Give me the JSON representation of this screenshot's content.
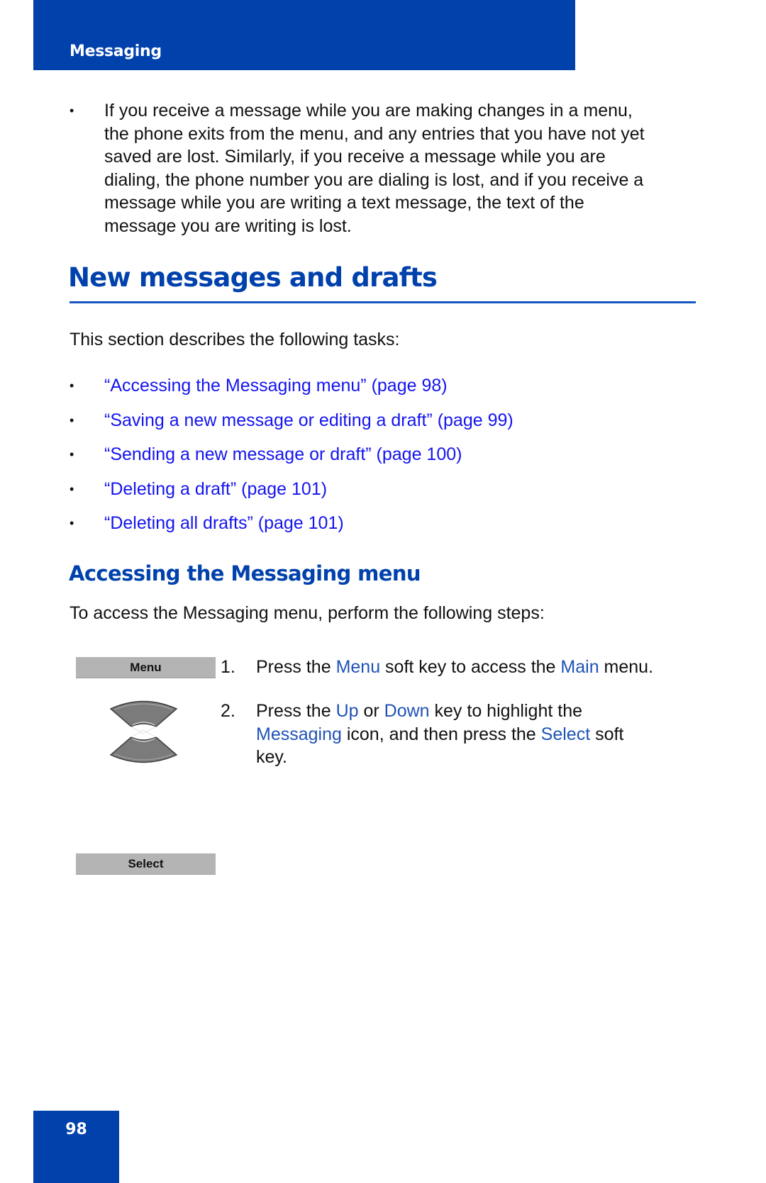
{
  "header": {
    "section_title": "Messaging",
    "color": "#0041ac"
  },
  "note": {
    "bullet": "•",
    "text": "If you receive a message while you are making changes in a menu, the phone exits from the menu, and any entries that you have not yet saved are lost. Similarly, if you receive a message while you are dialing, the phone number you are dialing is lost, and if you receive a message while you are writing a text message, the text of the message you are writing is lost.",
    "lines": [
      "If you receive a message while you are making changes in a menu,",
      "the phone exits from the menu, and any entries that you have not yet",
      "saved are lost. Similarly, if you receive a message while you are",
      "dialing, the phone number you are dialing is lost, and if you receive a",
      "message while you are writing a text message, the text of the",
      "message you are writing is lost."
    ]
  },
  "section": {
    "title": "New messages and drafts",
    "intro": "This section describes the following tasks:",
    "tasks": [
      {
        "label": "“Accessing the Messaging menu” (page 98)"
      },
      {
        "label": "“Saving a new message or editing a draft” (page 99)"
      },
      {
        "label": "“Sending a new message or draft” (page 100)"
      },
      {
        "label": "“Deleting a draft” (page 101)"
      },
      {
        "label": "“Deleting all drafts” (page 101)"
      }
    ],
    "link_color": "#1414f0"
  },
  "subsection": {
    "title": "Accessing the Messaging menu",
    "intro": "To access the Messaging menu, perform the following steps:"
  },
  "softkeys": {
    "menu": "Menu",
    "select": "Select"
  },
  "nav_key_icon": "up-down-navigation-key-icon",
  "steps": [
    {
      "number": "1.",
      "parts": {
        "t1": "Press the ",
        "k1": "Menu",
        "t2": " soft key to access the ",
        "k2": "Main",
        "t3": " menu."
      }
    },
    {
      "number": "2.",
      "parts": {
        "t1": "Press the ",
        "k1": "Up",
        "t2": " or ",
        "k2": "Down",
        "t3": " key to highlight the",
        "k3": "Messaging",
        "t4": " icon, and then press the ",
        "k4": "Select",
        "t5": " soft",
        "t6": "key."
      }
    }
  ],
  "highlight_color": "#1f52b6",
  "footer": {
    "page_number": "98"
  }
}
